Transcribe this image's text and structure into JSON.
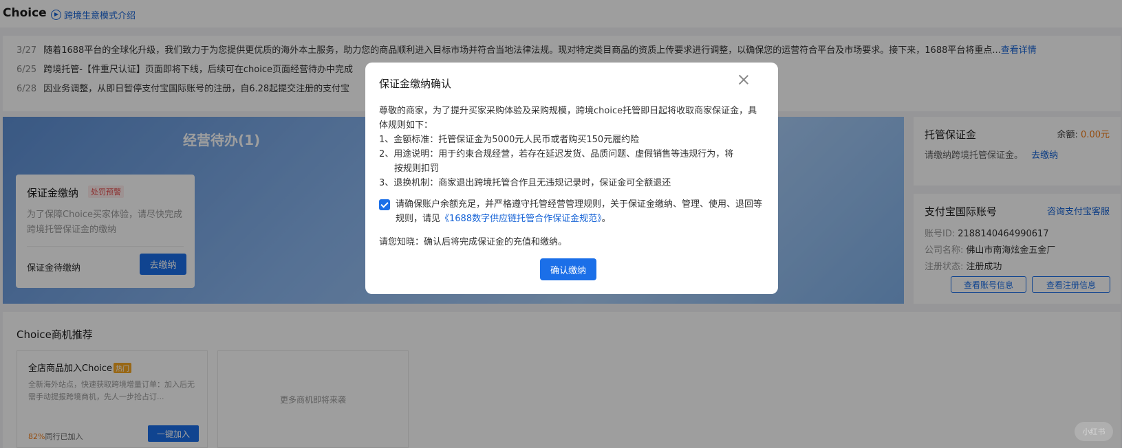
{
  "header": {
    "brand": "Choice",
    "mode_link": "跨境生意模式介绍"
  },
  "notices": [
    {
      "date": "3/27",
      "text": "随着1688平台的全球化升级，我们致力于为您提供更优质的海外本土服务，助力您的商品顺利进入目标市场并符合当地法律法规。现对特定类目商品的资质上传要求进行调整，以确保您的运营符合平台及市场要求。接下来，1688平台将重点...",
      "more": "查看详情"
    },
    {
      "date": "6/25",
      "text": "跨境托管-【件重尺认证】页面即将下线，后续可在choice页面经营待办中完成"
    },
    {
      "date": "6/28",
      "text": "因业务调整，从即日暂停支付宝国际账号的注册，自6.28起提交注册的支付宝"
    }
  ],
  "banner": {
    "title": "经营待办(1)",
    "deposit_card": {
      "title": "保证金缴纳",
      "tag": "处罚预警",
      "desc": "为了保障Choice买家体验，请尽快完成跨境托管保证金的缴纳",
      "status": "保证金待缴纳",
      "button": "去缴纳"
    }
  },
  "custody_deposit": {
    "title": "托管保证金",
    "balance_label": "余额:",
    "balance_value": "0.00元",
    "prompt": "请缴纳跨境托管保证金。",
    "pay_link": "去缴纳"
  },
  "alipay": {
    "title": "支付宝国际账号",
    "service_link": "咨询支付宝客服",
    "account_id_label": "账号ID:",
    "account_id": "2188140464990617",
    "company_label": "公司名称:",
    "company": "佛山市南海炫金五金厂",
    "reg_status_label": "注册状态:",
    "reg_status": "注册成功",
    "btn_account": "查看账号信息",
    "btn_register": "查看注册信息"
  },
  "recommend": {
    "title": "Choice商机推荐",
    "card": {
      "title": "全店商品加入Choice",
      "hot": "热门",
      "desc": "全新海外站点，快速获取跨境增量订单：加入后无需手动提报跨境商机，先人一步抢占订...",
      "pct": "82%",
      "stat_suffix": "同行已加入",
      "button": "一键加入"
    },
    "more": "更多商机即将来袭"
  },
  "modal": {
    "title": "保证金缴纳确认",
    "intro": "尊敬的商家，为了提升买家采购体验及采购规模，跨境choice托管即日起将收取商家保证金，具体规则如下：",
    "rule1": "1、金额标准：托管保证金为5000元人民币或者购买150元履约险",
    "rule2a": "2、用途说明：用于约束合规经营，若存在延迟发货、品质问题、虚假销售等违规行为，将",
    "rule2b": "按规则扣罚",
    "rule3": "3、退换机制：商家退出跨境托管合作且无违规记录时，保证金可全额退还",
    "agree_text": "请确保账户余额充足，并严格遵守托管经营管理规则，关于保证金缴纳、管理、使用、退回等规则，请见",
    "agree_link": "《1688数字供应链托管合作保证金规范》",
    "agree_end": "。",
    "note": "请您知晓：确认后将完成保证金的充值和缴纳。",
    "confirm": "确认缴纳"
  },
  "watermark": "小红书"
}
